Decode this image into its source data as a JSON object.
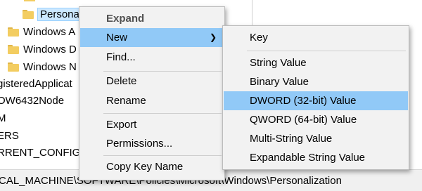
{
  "tree": {
    "items": [
      {
        "label": "Personalization",
        "selected": true
      },
      {
        "label": "Windows A"
      },
      {
        "label": "Windows D"
      },
      {
        "label": "Windows N"
      },
      {
        "label": "gisteredApplicat"
      },
      {
        "label": "OW6432Node"
      },
      {
        "label": "M"
      },
      {
        "label": "ERS"
      },
      {
        "label": "RRENT_CONFIG"
      }
    ]
  },
  "statusbar": {
    "path": "CAL_MACHINE\\SOFTWARE\\Policies\\Microsoft\\Windows\\Personalization"
  },
  "context_menu": {
    "expand": "Expand",
    "new": "New",
    "find": "Find...",
    "delete": "Delete",
    "rename": "Rename",
    "export": "Export",
    "permissions": "Permissions...",
    "copy_key_name": "Copy Key Name"
  },
  "submenu": {
    "key": "Key",
    "string_value": "String Value",
    "binary_value": "Binary Value",
    "dword_value": "DWORD (32-bit) Value",
    "qword_value": "QWORD (64-bit) Value",
    "multi_string_value": "Multi-String Value",
    "expandable_string_value": "Expandable String Value"
  },
  "colors": {
    "menu_background": "#f2f2f2",
    "menu_highlight": "#91c9f7",
    "folder": "#f3cd61",
    "tree_selection": "#cce8ff"
  },
  "icons": [
    "folder-icon",
    "chevron-right-icon",
    "expand-arrow-icon"
  ]
}
